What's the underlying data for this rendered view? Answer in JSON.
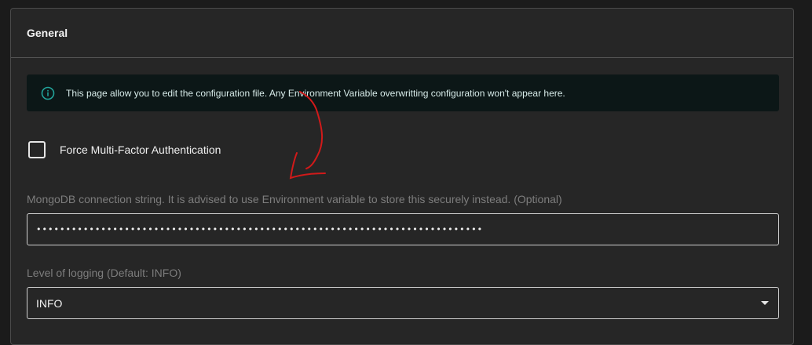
{
  "card": {
    "title": "General"
  },
  "alert": {
    "icon": "info-circle-icon",
    "text": "This page allow you to edit the configuration file. Any Environment Variable overwritting configuration won't appear here.",
    "icon_color": "#22a39a"
  },
  "mfa": {
    "label": "Force Multi-Factor Authentication",
    "checked": false
  },
  "mongo": {
    "label": "MongoDB connection string. It is advised to use Environment variable to store this securely instead. (Optional)",
    "value": "••••••••••••••••••••••••••••••••••••••••••••••••••••••••••••••••••••••••••••"
  },
  "logging": {
    "label": "Level of logging (Default: INFO)",
    "selected": "INFO"
  },
  "annotation": {
    "color": "#d11a1a",
    "shape": "hand-drawn-arrow"
  }
}
